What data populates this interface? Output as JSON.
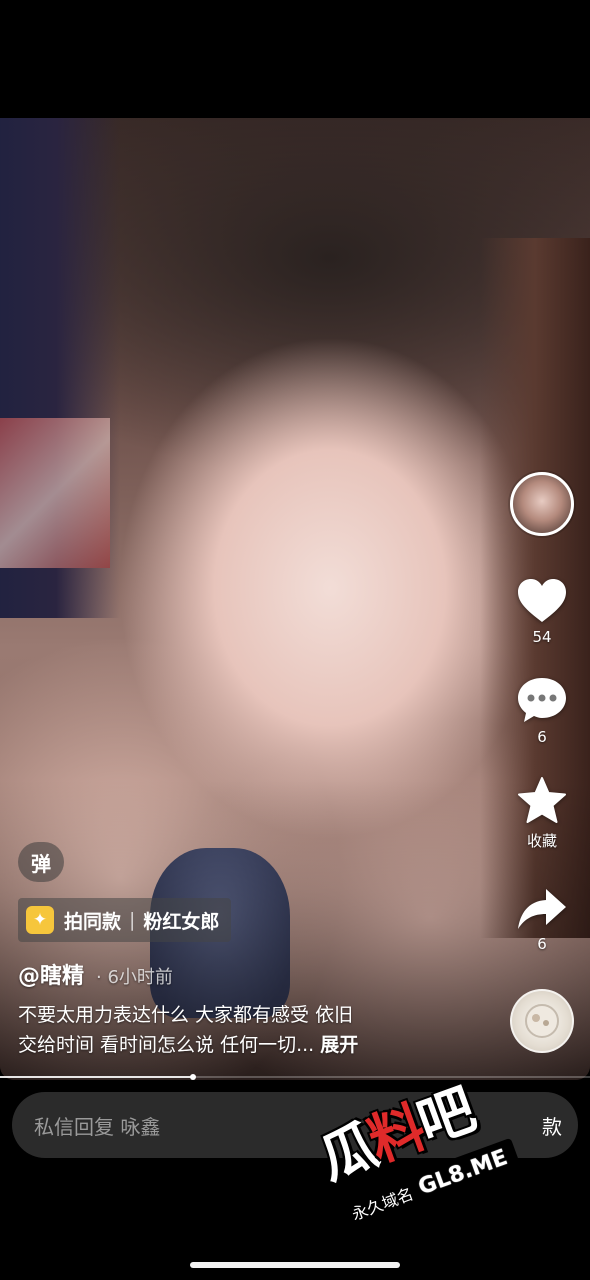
{
  "rail": {
    "like_count": "54",
    "comment_count": "6",
    "favorite_label": "收藏",
    "share_count": "6"
  },
  "overlay": {
    "danmu_label": "弹",
    "tag": {
      "primary": "拍同款",
      "secondary": "粉红女郎"
    },
    "author": "@瞎精",
    "time": "6小时前",
    "description_line1": "不要太用力表达什么 大家都有感受 依旧",
    "description_line2": "交给时间 看时间怎么说 任何一切...",
    "expand": "展开",
    "progress": 0.327
  },
  "reply_bar": {
    "placeholder": "私信回复 咏鑫",
    "button_label": "款"
  },
  "watermark": {
    "logo_a": "瓜",
    "logo_b": "料",
    "logo_c": "吧",
    "tagline": "永久域名",
    "domain": "GL8.ME"
  },
  "colors": {
    "accent_tag": "#f6c63c",
    "watermark_red": "#e02a2a"
  }
}
